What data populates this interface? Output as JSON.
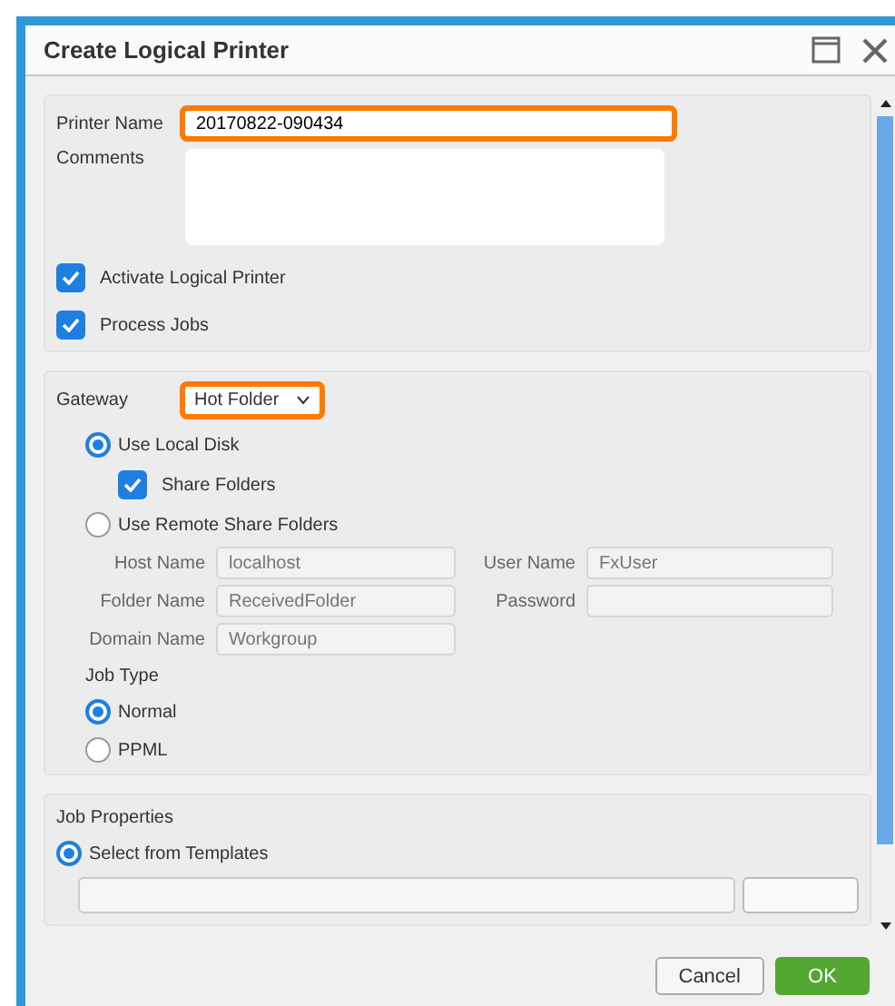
{
  "window": {
    "title": "Create Logical Printer"
  },
  "general": {
    "printer_name_label": "Printer Name",
    "printer_name": "20170822-090434",
    "printer_name_highlighted": true,
    "comments_label": "Comments",
    "checkboxes": [
      {
        "label": "Activate Logical Printer",
        "checked": true
      },
      {
        "label": "Process Jobs",
        "checked": true
      }
    ]
  },
  "gateway": {
    "label": "Gateway",
    "value": "Hot Folder",
    "highlighted": true,
    "local_disk": {
      "label": "Use Local Disk",
      "selected": true
    },
    "share_folders": {
      "label": "Share Folders",
      "checked": true
    },
    "remote": {
      "label": "Use Remote Share Folders",
      "selected": false
    },
    "remote_fields": [
      {
        "label": "Host Name",
        "placeholder": "localhost",
        "disabled": true
      },
      {
        "label": "User Name",
        "placeholder": "FxUser",
        "disabled": true
      },
      {
        "label": "Folder Name",
        "placeholder": "ReceivedFolder",
        "disabled": true
      },
      {
        "label": "Password",
        "disabled": true
      },
      {
        "label": "Domain Name",
        "placeholder": "Workgroup",
        "disabled": true
      }
    ],
    "job_type_label": "Job Type",
    "job_types": [
      {
        "label": "Normal",
        "selected": true
      },
      {
        "label": "PPML",
        "selected": false
      }
    ]
  },
  "job_properties": {
    "label": "Job Properties",
    "options": [
      {
        "label": "Select from Templates",
        "selected": true
      }
    ]
  },
  "buttons": [
    {
      "label": "Cancel",
      "kind": "secondary"
    },
    {
      "label": "OK",
      "kind": "primary"
    }
  ]
}
